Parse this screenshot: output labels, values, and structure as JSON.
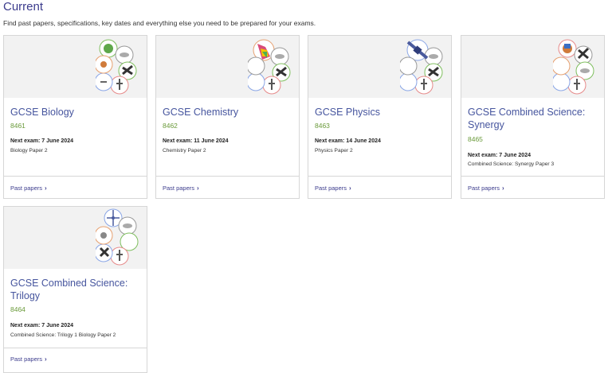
{
  "page": {
    "heading": "Current",
    "intro": "Find past papers, specifications, key dates and everything else you need to be prepared for your exams."
  },
  "cards": [
    {
      "title": "GCSE Biology",
      "code": "8461",
      "next_exam": "Next exam: 7 June 2024",
      "paper": "Biology Paper 2",
      "link": "Past papers"
    },
    {
      "title": "GCSE Chemistry",
      "code": "8462",
      "next_exam": "Next exam: 11 June 2024",
      "paper": "Chemistry Paper 2",
      "link": "Past papers"
    },
    {
      "title": "GCSE Physics",
      "code": "8463",
      "next_exam": "Next exam: 14 June 2024",
      "paper": "Physics Paper 2",
      "link": "Past papers"
    },
    {
      "title": "GCSE Combined Science: Synergy",
      "code": "8465",
      "next_exam": "Next exam: 7 June 2024",
      "paper": "Combined Science: Synergy Paper 3",
      "link": "Past papers"
    },
    {
      "title": "GCSE Combined Science: Trilogy",
      "code": "8464",
      "next_exam": "Next exam: 7 June 2024",
      "paper": "Combined Science: Trilogy 1 Biology Paper 2",
      "link": "Past papers"
    }
  ],
  "colors": {
    "title": "#46559e",
    "code": "#6a9a3a",
    "link": "#3b3b8c"
  }
}
